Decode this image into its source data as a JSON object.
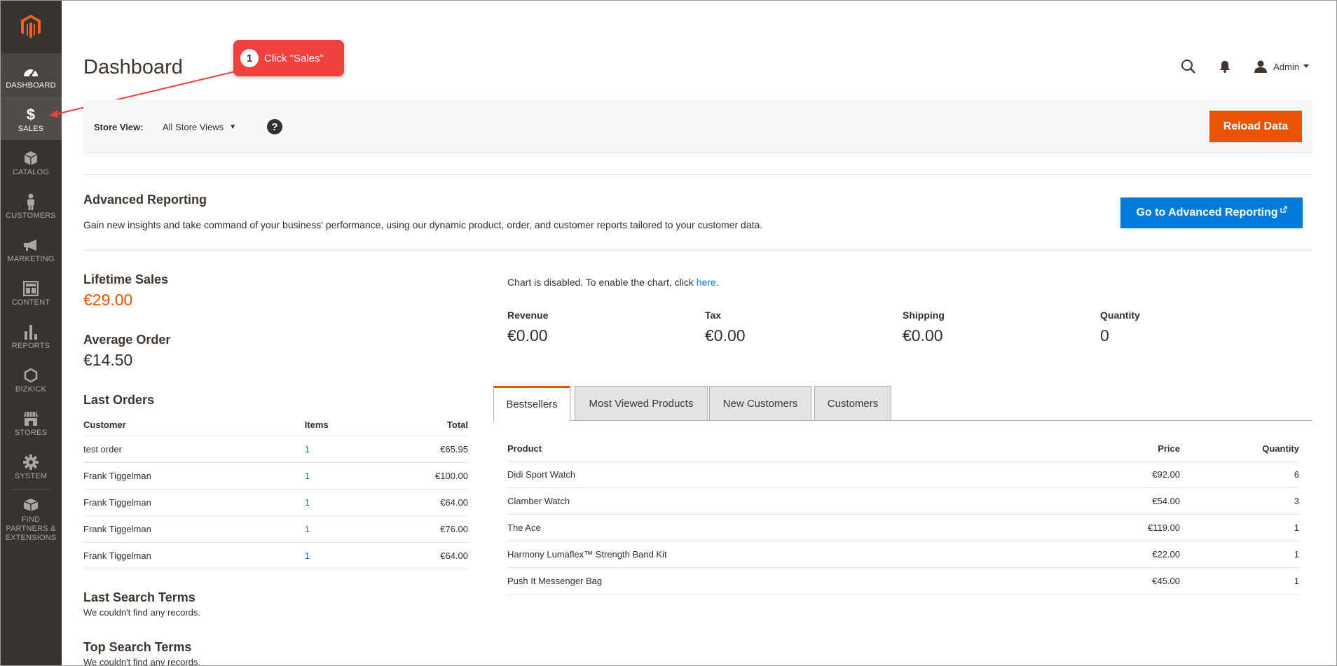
{
  "sidebar": {
    "items": [
      {
        "label": "DASHBOARD"
      },
      {
        "label": "SALES"
      },
      {
        "label": "CATALOG"
      },
      {
        "label": "CUSTOMERS"
      },
      {
        "label": "MARKETING"
      },
      {
        "label": "CONTENT"
      },
      {
        "label": "REPORTS"
      },
      {
        "label": "BIZKICK"
      },
      {
        "label": "STORES"
      },
      {
        "label": "SYSTEM"
      },
      {
        "label": "FIND PARTNERS & EXTENSIONS"
      }
    ]
  },
  "header": {
    "title": "Dashboard",
    "user": "Admin"
  },
  "callout": {
    "number": "1",
    "text": "Click \"Sales\""
  },
  "store_view": {
    "label": "Store View:",
    "selected": "All Store Views",
    "help": "?",
    "reload": "Reload Data"
  },
  "advanced_reporting": {
    "title": "Advanced Reporting",
    "description": "Gain new insights and take command of your business' performance, using our dynamic product, order, and customer reports tailored to your customer data.",
    "button": "Go to Advanced Reporting"
  },
  "stats": {
    "lifetime_label": "Lifetime Sales",
    "lifetime_value": "€29.00",
    "average_label": "Average Order",
    "average_value": "€14.50"
  },
  "last_orders": {
    "title": "Last Orders",
    "columns": [
      "Customer",
      "Items",
      "Total"
    ],
    "rows": [
      {
        "customer": "test order",
        "items": "1",
        "total": "€65.95"
      },
      {
        "customer": "Frank Tiggelman",
        "items": "1",
        "total": "€100.00"
      },
      {
        "customer": "Frank Tiggelman",
        "items": "1",
        "total": "€64.00"
      },
      {
        "customer": "Frank Tiggelman",
        "items": "1",
        "total": "€76.00"
      },
      {
        "customer": "Frank Tiggelman",
        "items": "1",
        "total": "€64.00"
      }
    ]
  },
  "last_search": {
    "title": "Last Search Terms",
    "empty": "We couldn't find any records."
  },
  "top_search": {
    "title": "Top Search Terms",
    "empty": "We couldn't find any records."
  },
  "chart_note": {
    "text": "Chart is disabled. To enable the chart, click ",
    "link": "here",
    "suffix": "."
  },
  "totals": [
    {
      "label": "Revenue",
      "value": "€0.00"
    },
    {
      "label": "Tax",
      "value": "€0.00"
    },
    {
      "label": "Shipping",
      "value": "€0.00"
    },
    {
      "label": "Quantity",
      "value": "0"
    }
  ],
  "tabs": [
    {
      "label": "Bestsellers"
    },
    {
      "label": "Most Viewed Products"
    },
    {
      "label": "New Customers"
    },
    {
      "label": "Customers"
    }
  ],
  "bestsellers": {
    "columns": [
      "Product",
      "Price",
      "Quantity"
    ],
    "rows": [
      {
        "product": "Didi Sport Watch",
        "price": "€92.00",
        "qty": "6"
      },
      {
        "product": "Clamber Watch",
        "price": "€54.00",
        "qty": "3"
      },
      {
        "product": "The Ace",
        "price": "€119.00",
        "qty": "1"
      },
      {
        "product": "Harmony Lumaflex™ Strength Band Kit",
        "price": "€22.00",
        "qty": "1"
      },
      {
        "product": "Push It Messenger Bag",
        "price": "€45.00",
        "qty": "1"
      }
    ]
  },
  "colors": {
    "accent": "#eb5202",
    "link": "#007bdb",
    "sidebar": "#373330",
    "callout": "#f0413f"
  }
}
